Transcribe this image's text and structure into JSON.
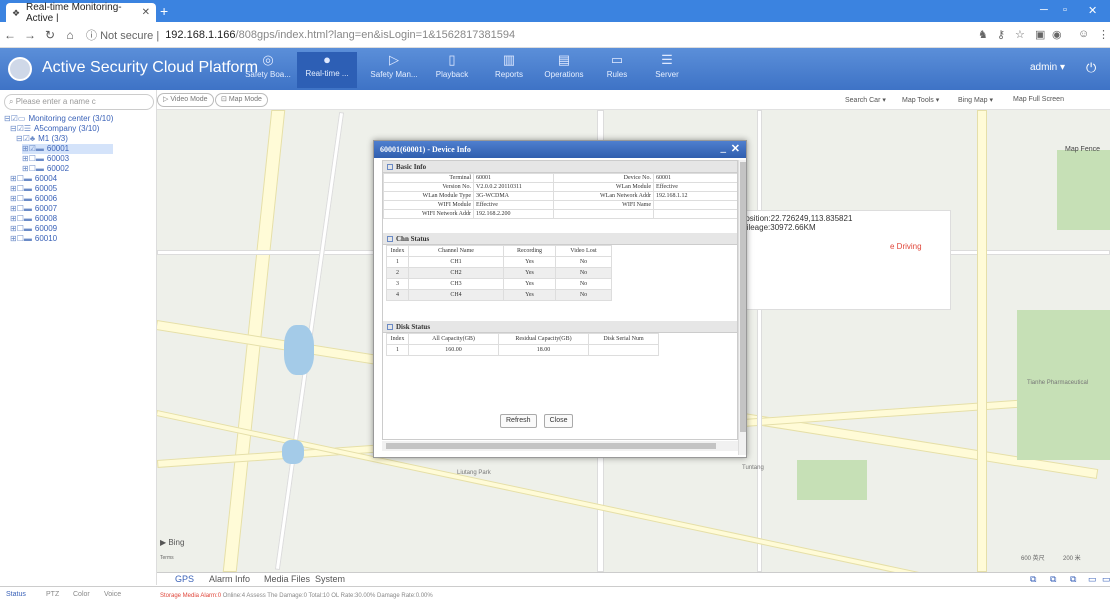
{
  "browser": {
    "tab_title": "Real-time Monitoring-Active |",
    "not_secure": "Not secure",
    "url_host": "192.168.1.166",
    "url_path": "/808gps/index.html?lang=en&isLogin=1&1562817381594"
  },
  "app": {
    "title": "Active Security Cloud Platform",
    "nav": [
      {
        "label": "Safety Boa..."
      },
      {
        "label": "Real-time ..."
      },
      {
        "label": "Safety Man..."
      },
      {
        "label": "Playback"
      },
      {
        "label": "Reports"
      },
      {
        "label": "Operations"
      },
      {
        "label": "Rules"
      },
      {
        "label": "Server"
      }
    ],
    "user": "admin ▾"
  },
  "sidebar": {
    "search_placeholder": "Please enter a name c",
    "tree": [
      "Monitoring center (3/10)",
      "A5company (3/10)",
      "M1 (3/3)",
      "60001",
      "60003",
      "60002",
      "60004",
      "60005",
      "60006",
      "60007",
      "60008",
      "60009",
      "60010"
    ]
  },
  "maptools": {
    "video_mode": "Video Mode",
    "map_mode": "Map Mode",
    "search_car": "Search Car ▾",
    "map_tools": "Map Tools ▾",
    "bing_map": "Bing Map ▾",
    "full_screen": "Map Full Screen",
    "map_fence": "Map Fence"
  },
  "map_popup": {
    "line1": "Position:22.726249,113.835821",
    "line2": "Mileage:30972.66KM",
    "driving": "e Driving"
  },
  "dialog": {
    "title": "60001(60001) - Device Info",
    "basic_info": {
      "header": "Basic Info",
      "rows": [
        [
          "Terminal",
          "60001",
          "Device No.",
          "60001"
        ],
        [
          "Version No.",
          "V2.0.0.2 20110311",
          "WLan Module",
          "Effective"
        ],
        [
          "WLan Module Type",
          "3G-WCDMA",
          "WLan Network Addr",
          "192.168.1.12"
        ],
        [
          "WIFI Module",
          "Effective",
          "WIFI Name",
          ""
        ],
        [
          "WIFI Network Addr",
          "192.168.2.200",
          "",
          ""
        ]
      ]
    },
    "chn_status": {
      "header": "Chn Status",
      "columns": [
        "Index",
        "Channel Name",
        "Recording",
        "Video Lost"
      ],
      "rows": [
        [
          "1",
          "CH1",
          "Yes",
          "No"
        ],
        [
          "2",
          "CH2",
          "Yes",
          "No"
        ],
        [
          "3",
          "CH3",
          "Yes",
          "No"
        ],
        [
          "4",
          "CH4",
          "Yes",
          "No"
        ]
      ]
    },
    "disk_status": {
      "header": "Disk Status",
      "columns": [
        "Index",
        "All Capacity(GB)",
        "Residual Capacity(GB)",
        "Disk Serial Num"
      ],
      "rows": [
        [
          "1",
          "160.00",
          "18.00",
          ""
        ]
      ]
    },
    "refresh": "Refresh",
    "close": "Close"
  },
  "bottom_tabs": [
    "GPS",
    "Alarm Info",
    "Media Files",
    "System"
  ],
  "status_tabs": [
    "Status",
    "PTZ",
    "Color",
    "Voice"
  ],
  "status": {
    "storage": "Storage Media Alarm:0",
    "rest": "Online:4 Assess The Damage:0 Total:10 OL Rate:30.00% Damage Rate:0.00%"
  },
  "map_labels": {
    "bing": "Bing",
    "terms": "Terms",
    "scale1": "600 英尺",
    "scale2": "200 米"
  }
}
